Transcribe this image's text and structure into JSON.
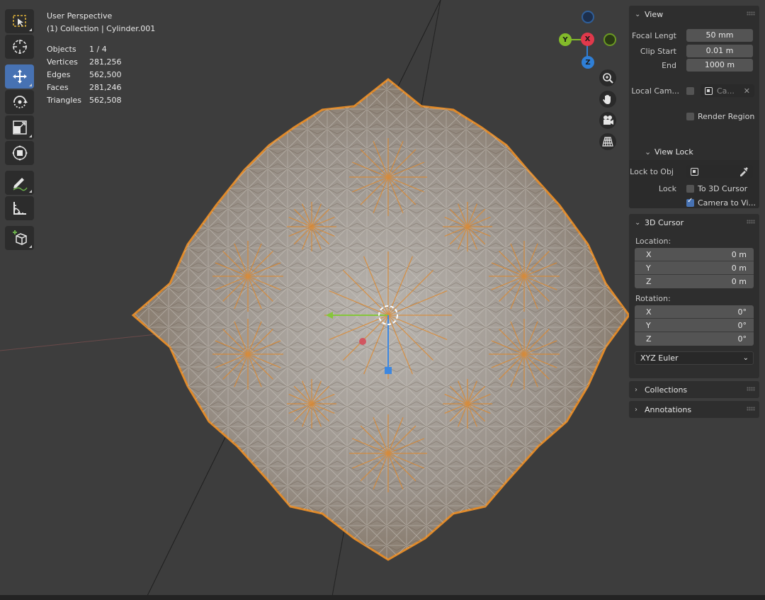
{
  "viewport": {
    "view_name": "User Perspective",
    "collection_path": "(1) Collection | Cylinder.001",
    "stats": [
      {
        "label": "Objects",
        "value": "1 / 4"
      },
      {
        "label": "Vertices",
        "value": "281,256"
      },
      {
        "label": "Edges",
        "value": "562,500"
      },
      {
        "label": "Faces",
        "value": "281,246"
      },
      {
        "label": "Triangles",
        "value": "562,508"
      }
    ]
  },
  "toolbar": {
    "tools": [
      {
        "name": "select-box-tool",
        "icon": "select-box-icon",
        "active": false
      },
      {
        "name": "cursor-tool",
        "icon": "cursor-icon",
        "active": false
      },
      {
        "name": "move-tool",
        "icon": "move-icon",
        "active": true
      },
      {
        "name": "rotate-tool",
        "icon": "rotate-icon",
        "active": false
      },
      {
        "name": "scale-tool",
        "icon": "scale-icon",
        "active": false
      },
      {
        "name": "transform-tool",
        "icon": "transform-icon",
        "active": false
      },
      {
        "name": "annotate-tool",
        "icon": "annotate-icon",
        "active": false
      },
      {
        "name": "measure-tool",
        "icon": "measure-icon",
        "active": false
      },
      {
        "name": "add-cube-tool",
        "icon": "add-cube-icon",
        "active": false
      }
    ]
  },
  "gizmo": {
    "x_label": "X",
    "y_label": "Y",
    "z_label": "Z",
    "colors": {
      "x": "#e0394b",
      "y": "#83bb2a",
      "z": "#2f7fd6"
    }
  },
  "sidebar": {
    "view": {
      "title": "View",
      "focal_length_label": "Focal Lengt",
      "focal_length_value": "50 mm",
      "clip_start_label": "Clip Start",
      "clip_start_value": "0.01 m",
      "clip_end_label": "End",
      "clip_end_value": "1000 m",
      "local_camera_label": "Local Cam...",
      "local_camera_value": "Ca...",
      "render_region_label": "Render Region"
    },
    "view_lock": {
      "title": "View Lock",
      "lock_to_obj_label": "Lock to Obj",
      "lock_label": "Lock",
      "to_3d_cursor_label": "To 3D Cursor",
      "to_3d_cursor_checked": false,
      "camera_to_view_label": "Camera to Vi...",
      "camera_to_view_checked": true
    },
    "cursor": {
      "title": "3D Cursor",
      "location_label": "Location:",
      "location": [
        {
          "axis": "X",
          "value": "0 m"
        },
        {
          "axis": "Y",
          "value": "0 m"
        },
        {
          "axis": "Z",
          "value": "0 m"
        }
      ],
      "rotation_label": "Rotation:",
      "rotation": [
        {
          "axis": "X",
          "value": "0°"
        },
        {
          "axis": "Y",
          "value": "0°"
        },
        {
          "axis": "Z",
          "value": "0°"
        }
      ],
      "rotation_mode": "XYZ Euler"
    },
    "collections": {
      "title": "Collections"
    },
    "annotations": {
      "title": "Annotations"
    }
  }
}
